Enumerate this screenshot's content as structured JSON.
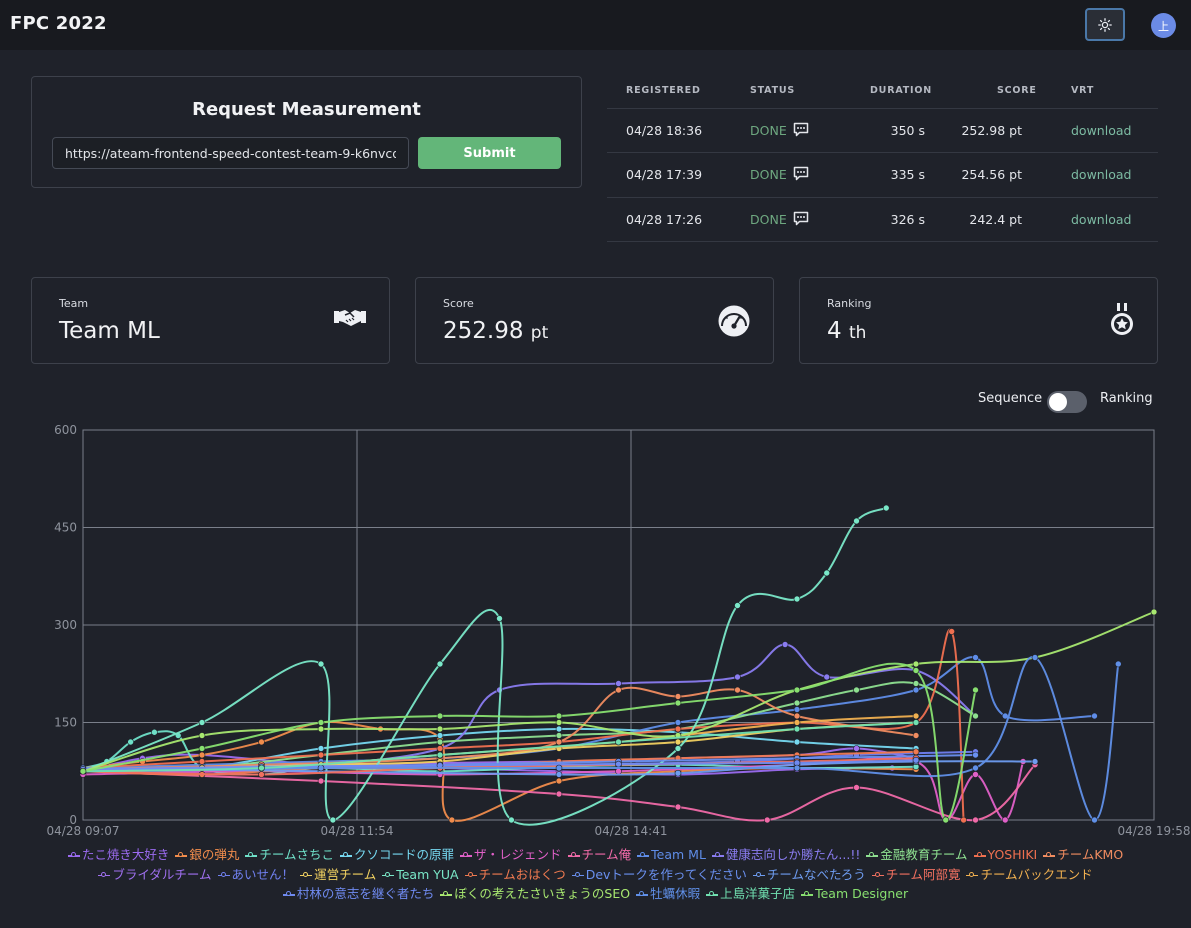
{
  "header": {
    "brand": "FPC 2022",
    "avatar_letter": "上",
    "theme_icon": "sun-icon"
  },
  "request": {
    "title": "Request Measurement",
    "url_value": "https://ateam-frontend-speed-contest-team-9-k6nvcdok",
    "submit_label": "Submit"
  },
  "measurements": {
    "headers": [
      "REGISTERED",
      "STATUS",
      "DURATION",
      "SCORE",
      "VRT"
    ],
    "rows": [
      {
        "registered": "04/28 18:36",
        "status": "DONE",
        "duration": "350 s",
        "score": "252.98 pt",
        "vrt": "download"
      },
      {
        "registered": "04/28 17:39",
        "status": "DONE",
        "duration": "335 s",
        "score": "254.56 pt",
        "vrt": "download"
      },
      {
        "registered": "04/28 17:26",
        "status": "DONE",
        "duration": "326 s",
        "score": "242.4 pt",
        "vrt": "download"
      }
    ]
  },
  "stats": {
    "team": {
      "label": "Team",
      "value": "Team ML",
      "icon": "handshake-icon"
    },
    "score": {
      "label": "Score",
      "value": "252.98",
      "unit": "pt",
      "icon": "speedometer-icon"
    },
    "ranking": {
      "label": "Ranking",
      "value": "4",
      "unit": "th",
      "icon": "medal-icon"
    }
  },
  "view_toggle": {
    "left_label": "Sequence",
    "right_label": "Ranking",
    "on": false
  },
  "chart_data": {
    "type": "line",
    "x_ticks": [
      "04/28 09:07",
      "04/28 11:54",
      "04/28 14:41",
      "04/28 19:58"
    ],
    "y_ticks": [
      "0",
      "150",
      "300",
      "450",
      "600"
    ],
    "ylim": [
      0,
      600
    ],
    "grid": true,
    "legend_position": "bottom",
    "series": [
      {
        "name": "たこ焼き大好き",
        "color": "#9b6bf0",
        "values": [
          [
            0,
            75
          ],
          [
            10,
            95
          ],
          [
            20,
            100
          ],
          [
            40,
            85
          ],
          [
            60,
            80
          ],
          [
            80,
            75
          ],
          [
            100,
            70
          ],
          [
            120,
            78
          ],
          [
            136,
            80
          ]
        ]
      },
      {
        "name": "銀の弾丸",
        "color": "#f08c4c",
        "values": [
          [
            0,
            80
          ],
          [
            10,
            90
          ],
          [
            20,
            100
          ],
          [
            30,
            120
          ],
          [
            40,
            150
          ],
          [
            50,
            140
          ],
          [
            60,
            125
          ],
          [
            62,
            0
          ],
          [
            80,
            60
          ],
          [
            100,
            75
          ],
          [
            120,
            80
          ],
          [
            140,
            78
          ]
        ]
      },
      {
        "name": "チームさちこ",
        "color": "#6fe0c8",
        "values": [
          [
            0,
            80
          ],
          [
            4,
            90
          ],
          [
            8,
            120
          ],
          [
            12,
            135
          ],
          [
            16,
            130
          ],
          [
            20,
            80
          ],
          [
            30,
            70
          ],
          [
            40,
            80
          ],
          [
            60,
            75
          ],
          [
            80,
            82
          ],
          [
            100,
            85
          ],
          [
            120,
            80
          ],
          [
            140,
            82
          ]
        ]
      },
      {
        "name": "クソコードの原罪",
        "color": "#76d8f0",
        "values": [
          [
            0,
            75
          ],
          [
            20,
            80
          ],
          [
            40,
            110
          ],
          [
            60,
            130
          ],
          [
            80,
            140
          ],
          [
            100,
            135
          ],
          [
            120,
            120
          ],
          [
            140,
            110
          ]
        ]
      },
      {
        "name": "ザ・レジェンド",
        "color": "#e060c8",
        "values": [
          [
            0,
            70
          ],
          [
            30,
            75
          ],
          [
            60,
            70
          ],
          [
            90,
            75
          ],
          [
            120,
            85
          ],
          [
            140,
            90
          ],
          [
            145,
            0
          ],
          [
            150,
            70
          ],
          [
            155,
            0
          ],
          [
            158,
            90
          ]
        ]
      },
      {
        "name": "チーム俺",
        "color": "#f06aa8",
        "values": [
          [
            0,
            75
          ],
          [
            40,
            60
          ],
          [
            80,
            40
          ],
          [
            100,
            20
          ],
          [
            115,
            0
          ],
          [
            130,
            50
          ],
          [
            150,
            0
          ],
          [
            160,
            85
          ]
        ]
      },
      {
        "name": "Team ML",
        "color": "#5f8de8",
        "values": [
          [
            0,
            80
          ],
          [
            20,
            85
          ],
          [
            40,
            90
          ],
          [
            60,
            95
          ],
          [
            80,
            110
          ],
          [
            100,
            150
          ],
          [
            120,
            170
          ],
          [
            140,
            200
          ],
          [
            150,
            250
          ],
          [
            155,
            160
          ],
          [
            170,
            160
          ]
        ]
      },
      {
        "name": "健康志向しか勝たん...!!",
        "color": "#8a7cf0",
        "values": [
          [
            0,
            75
          ],
          [
            30,
            80
          ],
          [
            60,
            110
          ],
          [
            70,
            200
          ],
          [
            90,
            210
          ],
          [
            110,
            220
          ],
          [
            118,
            270
          ],
          [
            125,
            220
          ],
          [
            140,
            230
          ],
          [
            150,
            160
          ]
        ]
      },
      {
        "name": "金融教育チーム",
        "color": "#8ee090",
        "values": [
          [
            0,
            75
          ],
          [
            20,
            80
          ],
          [
            40,
            100
          ],
          [
            60,
            120
          ],
          [
            80,
            130
          ],
          [
            100,
            140
          ],
          [
            120,
            180
          ],
          [
            130,
            200
          ],
          [
            140,
            210
          ],
          [
            150,
            160
          ]
        ]
      },
      {
        "name": "YOSHIKI",
        "color": "#f07050",
        "values": [
          [
            0,
            80
          ],
          [
            20,
            90
          ],
          [
            40,
            100
          ],
          [
            60,
            110
          ],
          [
            80,
            120
          ],
          [
            100,
            140
          ],
          [
            120,
            150
          ],
          [
            140,
            150
          ],
          [
            146,
            290
          ],
          [
            148,
            0
          ]
        ]
      },
      {
        "name": "チームKMO",
        "color": "#f08c60",
        "values": [
          [
            0,
            78
          ],
          [
            30,
            85
          ],
          [
            60,
            95
          ],
          [
            80,
            120
          ],
          [
            90,
            200
          ],
          [
            100,
            190
          ],
          [
            110,
            200
          ],
          [
            120,
            160
          ],
          [
            140,
            130
          ]
        ]
      },
      {
        "name": "ブライダルチーム",
        "color": "#a070f0",
        "values": [
          [
            0,
            75
          ],
          [
            40,
            85
          ],
          [
            80,
            90
          ],
          [
            100,
            95
          ],
          [
            120,
            100
          ],
          [
            130,
            110
          ],
          [
            140,
            95
          ]
        ]
      },
      {
        "name": "あいせん！",
        "color": "#7080f0",
        "values": [
          [
            0,
            75
          ],
          [
            40,
            80
          ],
          [
            80,
            85
          ],
          [
            110,
            90
          ],
          [
            130,
            100
          ],
          [
            150,
            105
          ]
        ]
      },
      {
        "name": "運営チーム",
        "color": "#f0d060",
        "values": [
          [
            0,
            75
          ],
          [
            20,
            80
          ],
          [
            40,
            85
          ],
          [
            60,
            90
          ],
          [
            80,
            110
          ],
          [
            100,
            120
          ],
          [
            120,
            140
          ],
          [
            140,
            150
          ]
        ]
      },
      {
        "name": "Team YUA",
        "color": "#7ae8c8",
        "values": [
          [
            0,
            75
          ],
          [
            20,
            150
          ],
          [
            40,
            240
          ],
          [
            42,
            0
          ],
          [
            60,
            240
          ],
          [
            70,
            310
          ],
          [
            72,
            0
          ],
          [
            100,
            110
          ],
          [
            110,
            330
          ],
          [
            120,
            340
          ],
          [
            125,
            380
          ],
          [
            130,
            460
          ],
          [
            135,
            480
          ]
        ]
      },
      {
        "name": "チームおはくつ",
        "color": "#f07a50",
        "values": [
          [
            0,
            75
          ],
          [
            20,
            70
          ],
          [
            40,
            80
          ],
          [
            60,
            80
          ],
          [
            80,
            90
          ],
          [
            100,
            95
          ],
          [
            120,
            100
          ],
          [
            140,
            105
          ]
        ]
      },
      {
        "name": "Devトークを作ってください",
        "color": "#6a90f0",
        "values": [
          [
            0,
            75
          ],
          [
            30,
            80
          ],
          [
            60,
            85
          ],
          [
            90,
            90
          ],
          [
            120,
            95
          ],
          [
            150,
            100
          ]
        ]
      },
      {
        "name": "チームなべたろう",
        "color": "#6e9cf0",
        "values": [
          [
            0,
            80
          ],
          [
            40,
            75
          ],
          [
            80,
            70
          ],
          [
            100,
            72
          ],
          [
            120,
            85
          ],
          [
            140,
            90
          ],
          [
            160,
            90
          ]
        ]
      },
      {
        "name": "チーム阿部寛",
        "color": "#f07060",
        "values": [
          [
            0,
            75
          ],
          [
            30,
            70
          ],
          [
            60,
            80
          ],
          [
            90,
            85
          ],
          [
            120,
            90
          ],
          [
            140,
            95
          ]
        ]
      },
      {
        "name": "チームバックエンド",
        "color": "#f0b050",
        "values": [
          [
            0,
            75
          ],
          [
            30,
            80
          ],
          [
            60,
            100
          ],
          [
            90,
            120
          ],
          [
            120,
            150
          ],
          [
            140,
            160
          ]
        ]
      },
      {
        "name": "村林の意志を継ぐ者たち",
        "color": "#6f8af0",
        "values": [
          [
            0,
            78
          ],
          [
            30,
            82
          ],
          [
            60,
            84
          ],
          [
            90,
            86
          ],
          [
            120,
            88
          ],
          [
            140,
            92
          ]
        ]
      },
      {
        "name": "ぼくの考えたさいきょうのSEO",
        "color": "#a8e870",
        "values": [
          [
            0,
            75
          ],
          [
            20,
            130
          ],
          [
            40,
            140
          ],
          [
            60,
            140
          ],
          [
            80,
            150
          ],
          [
            100,
            130
          ],
          [
            120,
            200
          ],
          [
            140,
            240
          ],
          [
            160,
            250
          ],
          [
            180,
            320
          ]
        ]
      },
      {
        "name": "牡蠣休暇",
        "color": "#6090e8",
        "values": [
          [
            0,
            75
          ],
          [
            40,
            80
          ],
          [
            80,
            80
          ],
          [
            120,
            80
          ],
          [
            150,
            80
          ],
          [
            160,
            250
          ],
          [
            170,
            0
          ],
          [
            174,
            240
          ]
        ]
      },
      {
        "name": "上島洋菓子店",
        "color": "#70e0b0",
        "values": [
          [
            0,
            75
          ],
          [
            30,
            80
          ],
          [
            60,
            100
          ],
          [
            90,
            120
          ],
          [
            120,
            140
          ],
          [
            140,
            150
          ]
        ]
      },
      {
        "name": "Team Designer",
        "color": "#88e070",
        "values": [
          [
            0,
            75
          ],
          [
            20,
            110
          ],
          [
            40,
            150
          ],
          [
            60,
            160
          ],
          [
            80,
            160
          ],
          [
            100,
            180
          ],
          [
            120,
            200
          ],
          [
            140,
            230
          ],
          [
            145,
            0
          ],
          [
            150,
            200
          ]
        ]
      }
    ]
  }
}
